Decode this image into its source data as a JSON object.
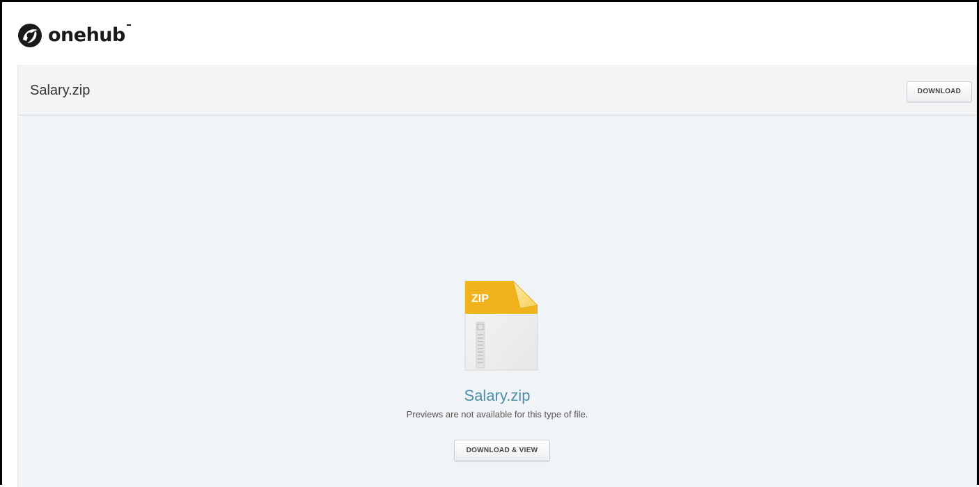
{
  "header": {
    "logo_text": "onehub",
    "logo_icon": "onehub-logo-icon"
  },
  "viewer": {
    "file_name": "Salary.zip",
    "download_label": "DOWNLOAD"
  },
  "preview": {
    "file_type_label": "ZIP",
    "file_icon": "zip-file-icon",
    "file_name": "Salary.zip",
    "message": "Previews are not available for this type of file.",
    "download_view_label": "DOWNLOAD & VIEW"
  },
  "colors": {
    "accent_link": "#4f8fa8",
    "zip_yellow": "#f0b31d",
    "viewer_bg": "#f0f4f6"
  }
}
